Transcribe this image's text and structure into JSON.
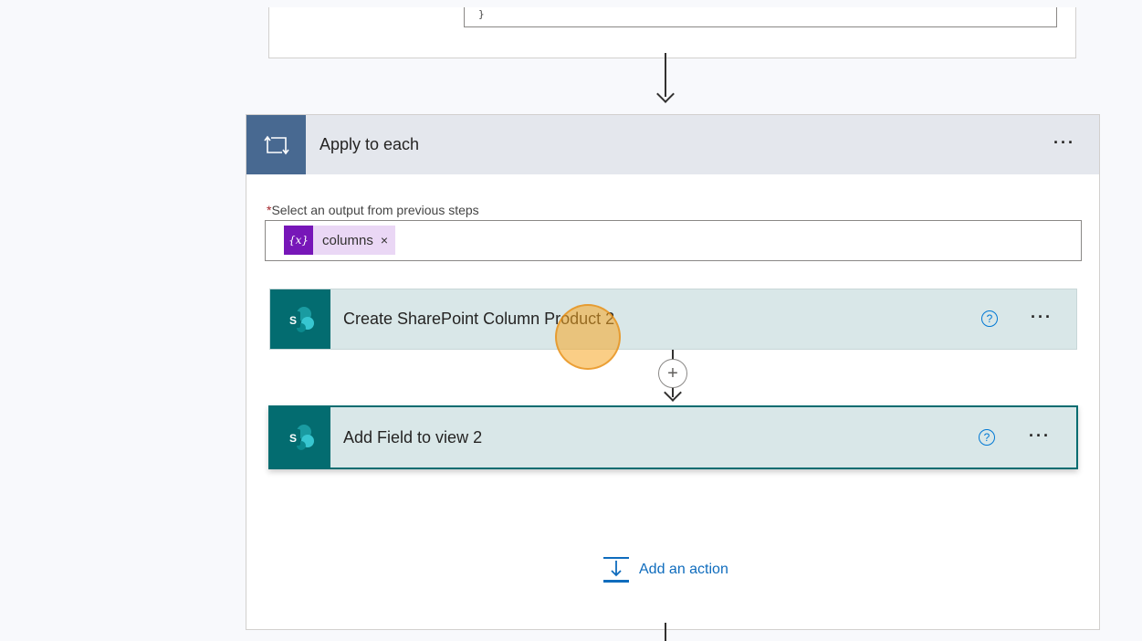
{
  "previous_step": {
    "code_line": "}"
  },
  "loop": {
    "title": "Apply to each",
    "more_label": "···",
    "field": {
      "required_mark": "*",
      "label": "Select an output from previous steps"
    },
    "token": {
      "icon_text": "{x}",
      "label": "columns",
      "remove_label": "×"
    },
    "actions": [
      {
        "title": "Create SharePoint Column Product 2",
        "help_label": "?",
        "more_label": "···",
        "icon_letter": "S"
      },
      {
        "title": "Add Field to view 2",
        "help_label": "?",
        "more_label": "···",
        "icon_letter": "S"
      }
    ],
    "insert_label": "+",
    "add_action_label": "Add an action"
  },
  "colors": {
    "loop_accent": "#486991",
    "sharepoint_accent": "#036c70",
    "token_accent": "#7716b8",
    "link": "#0f6cbd",
    "cursor_highlight": "#f5a623"
  }
}
